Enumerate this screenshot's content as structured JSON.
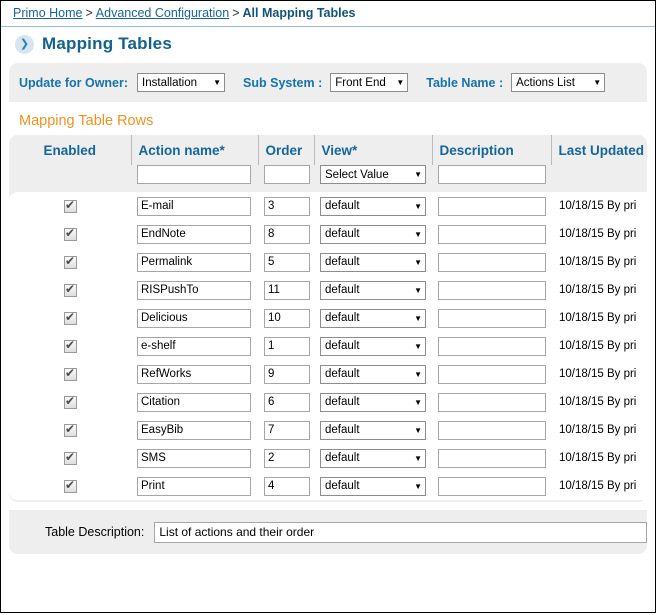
{
  "breadcrumb": {
    "home": "Primo Home",
    "separator": ">",
    "section": "Advanced Configuration",
    "current": "All Mapping Tables"
  },
  "page": {
    "title": "Mapping Tables",
    "chevron_icon": "chevron-right-icon"
  },
  "filters": {
    "owner_label": "Update for Owner:",
    "owner_value": "Installation",
    "subsystem_label": "Sub System :",
    "subsystem_value": "Front End",
    "tablename_label": "Table Name :",
    "tablename_value": "Actions List",
    "caret": "▼"
  },
  "rows_section": {
    "title": "Mapping Table Rows",
    "columns": [
      "Enabled",
      "Action name*",
      "Order",
      "View*",
      "Description",
      "Last Updated"
    ],
    "filter_row": {
      "action_value": "",
      "action_placeholder": "",
      "order_value": "",
      "order_placeholder": "",
      "view_value": "Select Value",
      "description_value": "",
      "description_placeholder": ""
    },
    "rows": [
      {
        "enabled": true,
        "action": "E-mail",
        "order": "3",
        "view": "default",
        "description": "",
        "updated": "10/18/15  By pri"
      },
      {
        "enabled": true,
        "action": "EndNote",
        "order": "8",
        "view": "default",
        "description": "",
        "updated": "10/18/15  By pri"
      },
      {
        "enabled": true,
        "action": "Permalink",
        "order": "5",
        "view": "default",
        "description": "",
        "updated": "10/18/15  By pri"
      },
      {
        "enabled": true,
        "action": "RISPushTo",
        "order": "11",
        "view": "default",
        "description": "",
        "updated": "10/18/15  By pri"
      },
      {
        "enabled": true,
        "action": "Delicious",
        "order": "10",
        "view": "default",
        "description": "",
        "updated": "10/18/15  By pri"
      },
      {
        "enabled": true,
        "action": "e-shelf",
        "order": "1",
        "view": "default",
        "description": "",
        "updated": "10/18/15  By pri"
      },
      {
        "enabled": true,
        "action": "RefWorks",
        "order": "9",
        "view": "default",
        "description": "",
        "updated": "10/18/15  By pri"
      },
      {
        "enabled": true,
        "action": "Citation",
        "order": "6",
        "view": "default",
        "description": "",
        "updated": "10/18/15  By pri"
      },
      {
        "enabled": true,
        "action": "EasyBib",
        "order": "7",
        "view": "default",
        "description": "",
        "updated": "10/18/15  By pri"
      },
      {
        "enabled": true,
        "action": "SMS",
        "order": "2",
        "view": "default",
        "description": "",
        "updated": "10/18/15  By pri"
      },
      {
        "enabled": true,
        "action": "Print",
        "order": "4",
        "view": "default",
        "description": "",
        "updated": "10/18/15  By pri"
      }
    ]
  },
  "footer": {
    "label": "Table Description:",
    "value": "List of actions and their order",
    "placeholder": ""
  },
  "colors": {
    "link": "#1a6496",
    "heading": "#12618f",
    "label": "#1473ab",
    "accent_orange": "#ef9321",
    "panel": "#eeeeee",
    "border": "#a6a6a6"
  }
}
